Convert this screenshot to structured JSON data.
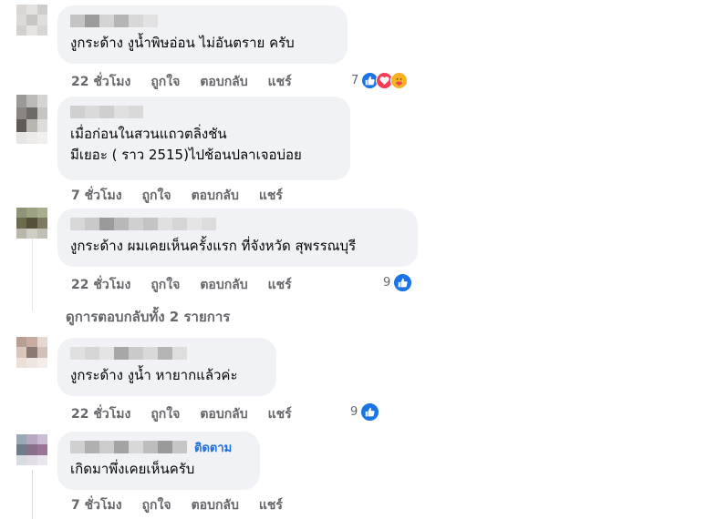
{
  "comments": [
    {
      "text_lines": [
        "งูกระด้าง งูน้ำพิษอ่อน ไม่อันตราย ครับ"
      ],
      "time": "22 ชั่วโมง",
      "like": "ถูกใจ",
      "reply": "ตอบกลับ",
      "share": "แชร์",
      "reaction_count": "7",
      "reaction_icons": [
        "like-icon",
        "love-icon",
        "care-icon"
      ]
    },
    {
      "text_lines": [
        "เมื่อก่อนในสวนแถวตลิ่งชัน",
        "มีเยอะ ( ราว 2515)ไปช้อนปลาเจอบ่อย"
      ],
      "time": "7 ชั่วโมง",
      "like": "ถูกใจ",
      "reply": "ตอบกลับ",
      "share": "แชร์"
    },
    {
      "text_lines": [
        "งูกระด้าง ผมเคยเห็นครั้งแรก ที่จังหวัด สุพรรณบุรี"
      ],
      "time": "22 ชั่วโมง",
      "like": "ถูกใจ",
      "reply": "ตอบกลับ",
      "share": "แชร์",
      "reaction_count": "9",
      "reaction_icons": [
        "like-icon"
      ]
    },
    {
      "text_lines": [
        "งูกระด้าง งูน้ำ หายากแล้วค่ะ"
      ],
      "time": "22 ชั่วโมง",
      "like": "ถูกใจ",
      "reply": "ตอบกลับ",
      "share": "แชร์",
      "reaction_count": "9",
      "reaction_icons": [
        "like-icon"
      ]
    },
    {
      "follow": "ติดตาม",
      "text_lines": [
        "เกิดมาพึ่งเคยเห็นครับ"
      ],
      "time": "7 ชั่วโมง",
      "like": "ถูกใจ",
      "reply": "ตอบกลับ",
      "share": "แชร์"
    }
  ],
  "view_replies": "ดูการตอบกลับทั้ง 2 รายการ",
  "colors": {
    "bubble": "#f0f2f5",
    "meta_text": "#65676b",
    "link_blue": "#216fdb",
    "like_blue": "#1b74e4",
    "love_red": "#f33e58",
    "care_yellow": "#f7b125"
  }
}
